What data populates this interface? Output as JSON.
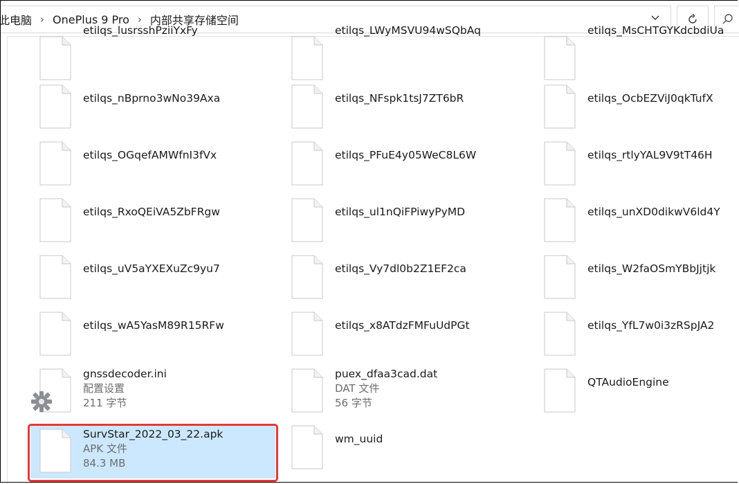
{
  "address_bar": {
    "crumbs": [
      "此电脑",
      "OnePlus 9 Pro",
      "内部共享存储空间"
    ],
    "separator": "›",
    "dropdown_icon": "chevron-down-icon",
    "refresh_icon": "refresh-icon",
    "search_icon": "search-icon"
  },
  "files": [
    {
      "name": "etilqs_lusrsshPziiYxFy",
      "type": "",
      "size": ""
    },
    {
      "name": "etilqs_LWyMSVU94wSQbAq",
      "type": "",
      "size": ""
    },
    {
      "name": "etilqs_MsCHTGYKdcbdiUa",
      "type": "",
      "size": ""
    },
    {
      "name": "etilqs_nBprno3wNo39Axa",
      "type": "",
      "size": ""
    },
    {
      "name": "etilqs_NFspk1tsJ7ZT6bR",
      "type": "",
      "size": ""
    },
    {
      "name": "etilqs_OcbEZViJ0qkTufX",
      "type": "",
      "size": ""
    },
    {
      "name": "etilqs_OGqefAMWfnI3fVx",
      "type": "",
      "size": ""
    },
    {
      "name": "etilqs_PFuE4y05WeC8L6W",
      "type": "",
      "size": ""
    },
    {
      "name": "etilqs_rtlyYAL9V9tT46H",
      "type": "",
      "size": ""
    },
    {
      "name": "etilqs_RxoQEiVA5ZbFRgw",
      "type": "",
      "size": ""
    },
    {
      "name": "etilqs_ul1nQiFPiwyPyMD",
      "type": "",
      "size": ""
    },
    {
      "name": "etilqs_unXD0dikwV6ld4Y",
      "type": "",
      "size": ""
    },
    {
      "name": "etilqs_uV5aYXEXuZc9yu7",
      "type": "",
      "size": ""
    },
    {
      "name": "etilqs_Vy7dl0b2Z1EF2ca",
      "type": "",
      "size": ""
    },
    {
      "name": "etilqs_W2faOSmYBbJjtjk",
      "type": "",
      "size": ""
    },
    {
      "name": "etilqs_wA5YasM89R15RFw",
      "type": "",
      "size": ""
    },
    {
      "name": "etilqs_x8ATdzFMFuUdPGt",
      "type": "",
      "size": ""
    },
    {
      "name": "etilqs_YfL7w0i3zRSpJA2",
      "type": "",
      "size": ""
    },
    {
      "name": "gnssdecoder.ini",
      "type": "配置设置",
      "size": "211 字节",
      "icon": "gear-icon"
    },
    {
      "name": "puex_dfaa3cad.dat",
      "type": "DAT 文件",
      "size": "56 字节"
    },
    {
      "name": "QTAudioEngine",
      "type": "",
      "size": ""
    },
    {
      "name": "SurvStar_2022_03_22.apk",
      "type": "APK 文件",
      "size": "84.3 MB",
      "selected": true
    },
    {
      "name": "wm_uuid",
      "type": "",
      "size": ""
    }
  ],
  "colors": {
    "selection": "#cce8ff",
    "highlight_outline": "#e53935"
  }
}
